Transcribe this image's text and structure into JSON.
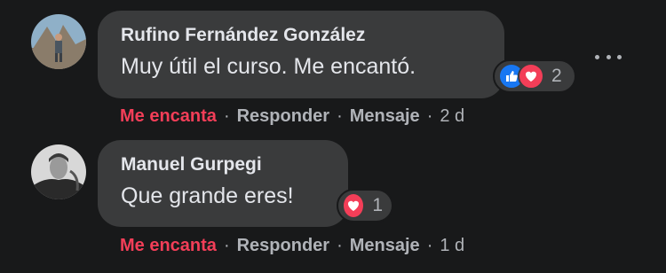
{
  "comments": [
    {
      "author": "Rufino Fernández González",
      "text": "Muy útil el curso. Me encantó.",
      "reaction_count": "2",
      "reaction_icons": [
        "like-icon",
        "love-icon"
      ],
      "actions": {
        "love": "Me encanta",
        "reply": "Responder",
        "message": "Mensaje",
        "time": "2 d"
      }
    },
    {
      "author": "Manuel Gurpegi",
      "text": "Que grande eres!",
      "reaction_count": "1",
      "reaction_icons": [
        "love-icon"
      ],
      "actions": {
        "love": "Me encanta",
        "reply": "Responder",
        "message": "Mensaje",
        "time": "1 d"
      }
    }
  ],
  "colors": {
    "background": "#18191a",
    "bubble": "#3a3b3c",
    "love": "#f33e58",
    "like": "#1877f2",
    "muted_text": "#b0b3b8"
  }
}
